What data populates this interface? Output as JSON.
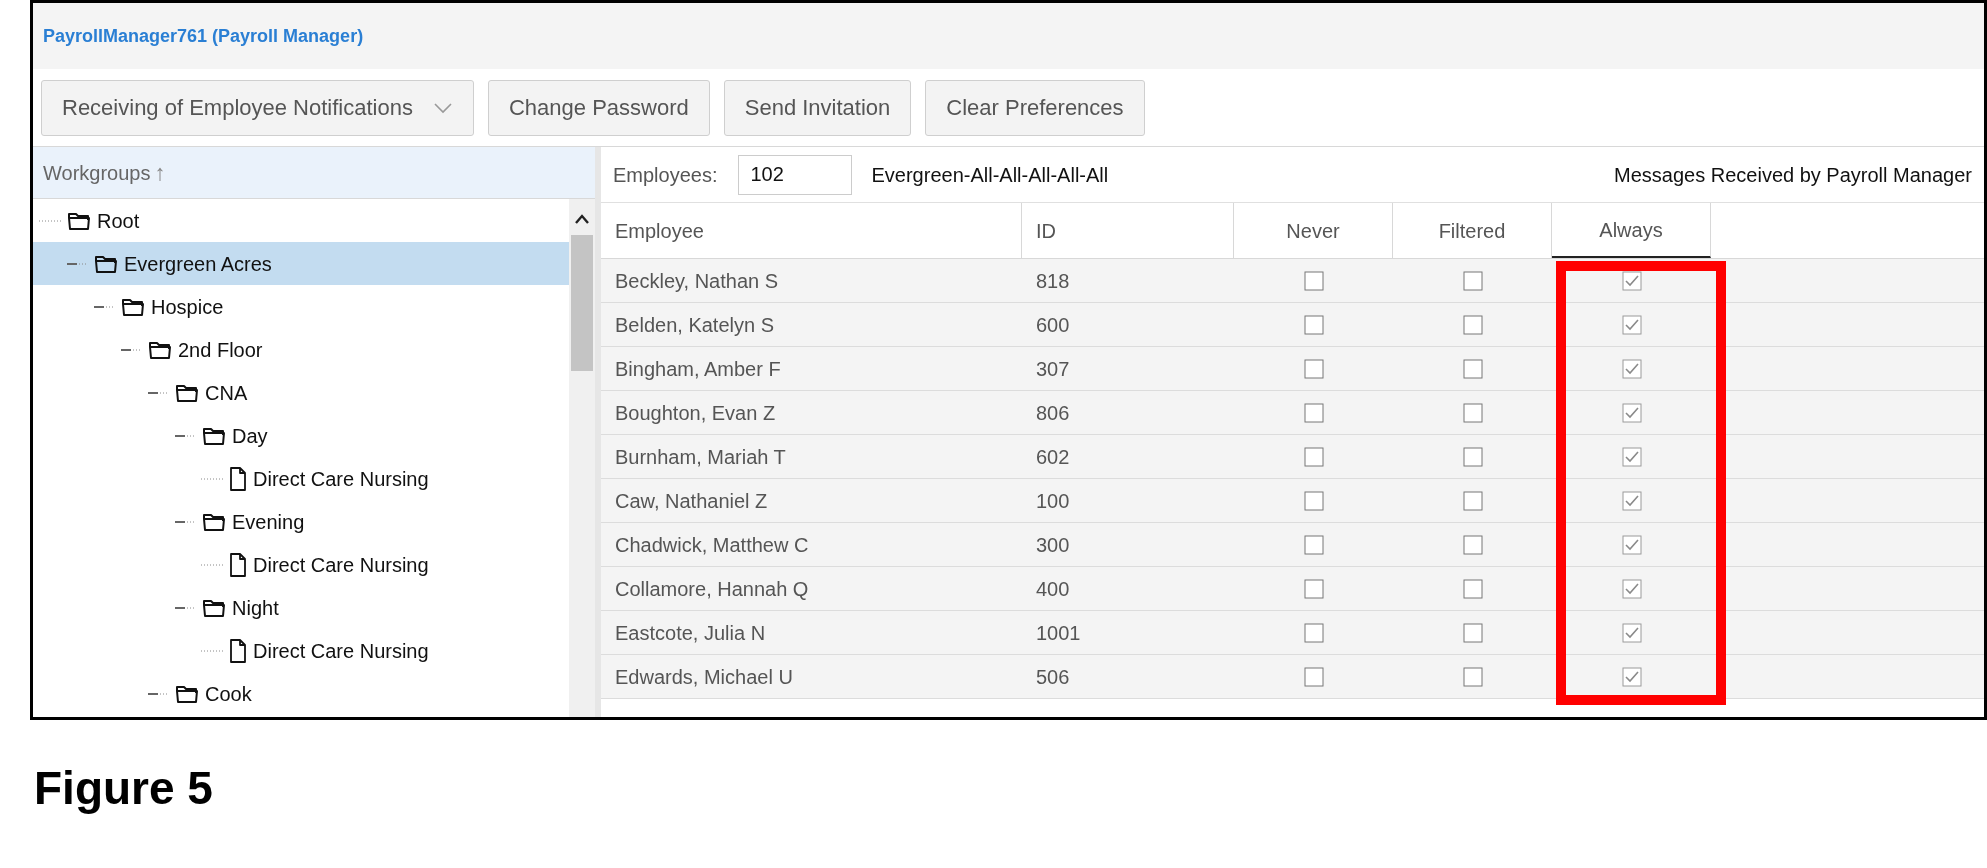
{
  "window": {
    "title": "PayrollManager761 (Payroll Manager)"
  },
  "toolbar": [
    {
      "kind": "dropdown",
      "label": "Receiving of Employee Notifications"
    },
    {
      "kind": "button",
      "label": "Change Password"
    },
    {
      "kind": "button",
      "label": "Send Invitation"
    },
    {
      "kind": "button",
      "label": "Clear Preferences"
    }
  ],
  "sidebar": {
    "header": "Workgroups",
    "sort_arrow": "↑",
    "tree": [
      {
        "label": "Root",
        "kind": "folder",
        "selected": false,
        "children": [
          {
            "label": "Evergreen Acres",
            "kind": "folder",
            "selected": true,
            "children": [
              {
                "label": "Hospice",
                "kind": "folder",
                "selected": false,
                "children": [
                  {
                    "label": "2nd Floor",
                    "kind": "folder",
                    "selected": false,
                    "children": [
                      {
                        "label": "CNA",
                        "kind": "folder",
                        "selected": false,
                        "children": [
                          {
                            "label": "Day",
                            "kind": "folder",
                            "selected": false,
                            "children": [
                              {
                                "label": "Direct Care Nursing",
                                "kind": "file",
                                "selected": false
                              }
                            ]
                          },
                          {
                            "label": "Evening",
                            "kind": "folder",
                            "selected": false,
                            "children": [
                              {
                                "label": "Direct Care Nursing",
                                "kind": "file",
                                "selected": false
                              }
                            ]
                          },
                          {
                            "label": "Night",
                            "kind": "folder",
                            "selected": false,
                            "children": [
                              {
                                "label": "Direct Care Nursing",
                                "kind": "file",
                                "selected": false
                              }
                            ]
                          }
                        ]
                      },
                      {
                        "label": "Cook",
                        "kind": "folder",
                        "selected": false
                      }
                    ]
                  }
                ]
              }
            ]
          }
        ]
      }
    ]
  },
  "filter": {
    "label": "Employees:",
    "count": "102",
    "group": "Evergreen-All-All-All-All-All",
    "caption": "Messages Received by Payroll Manager"
  },
  "table": {
    "columns": [
      {
        "label": "Employee",
        "selected": false
      },
      {
        "label": "ID",
        "selected": false
      },
      {
        "label": "Never",
        "selected": false
      },
      {
        "label": "Filtered",
        "selected": false
      },
      {
        "label": "Always",
        "selected": true
      }
    ],
    "rows": [
      {
        "employee": "Beckley, Nathan S",
        "id": "818",
        "never": false,
        "filtered": false,
        "always": true
      },
      {
        "employee": "Belden, Katelyn S",
        "id": "600",
        "never": false,
        "filtered": false,
        "always": true
      },
      {
        "employee": "Bingham, Amber F",
        "id": "307",
        "never": false,
        "filtered": false,
        "always": true
      },
      {
        "employee": "Boughton, Evan Z",
        "id": "806",
        "never": false,
        "filtered": false,
        "always": true
      },
      {
        "employee": "Burnham, Mariah T",
        "id": "602",
        "never": false,
        "filtered": false,
        "always": true
      },
      {
        "employee": "Caw, Nathaniel Z",
        "id": "100",
        "never": false,
        "filtered": false,
        "always": true
      },
      {
        "employee": "Chadwick, Matthew C",
        "id": "300",
        "never": false,
        "filtered": false,
        "always": true
      },
      {
        "employee": "Collamore, Hannah Q",
        "id": "400",
        "never": false,
        "filtered": false,
        "always": true
      },
      {
        "employee": "Eastcote, Julia N",
        "id": "1001",
        "never": false,
        "filtered": false,
        "always": true
      },
      {
        "employee": "Edwards, Michael U",
        "id": "506",
        "never": false,
        "filtered": false,
        "always": true
      }
    ]
  },
  "caption": "Figure 5"
}
